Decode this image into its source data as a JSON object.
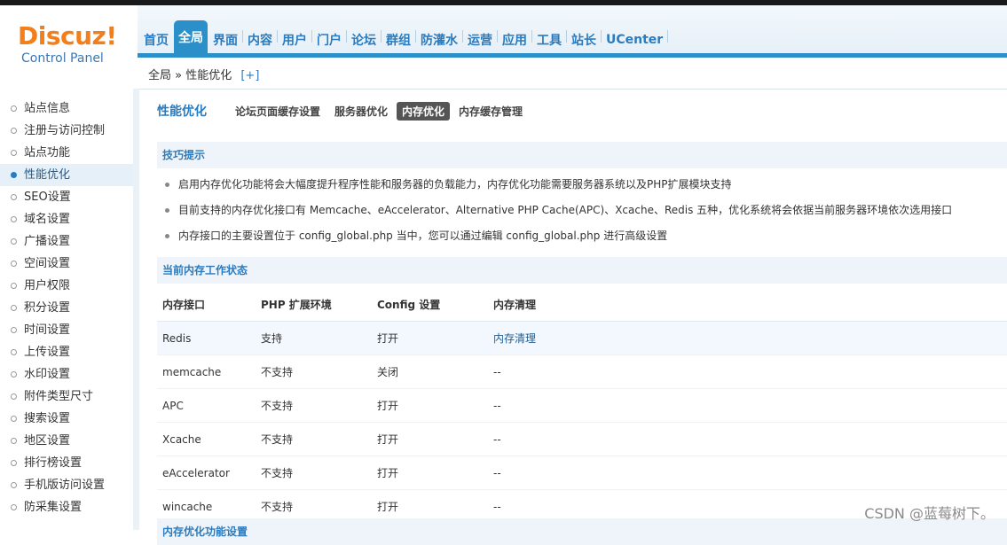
{
  "logo": {
    "title": "Discuz!",
    "subtitle": "Control Panel"
  },
  "nav": {
    "items": [
      "首页",
      "全局",
      "界面",
      "内容",
      "用户",
      "门户",
      "论坛",
      "群组",
      "防灌水",
      "运营",
      "应用",
      "工具",
      "站长",
      "UCenter"
    ],
    "active_index": 1
  },
  "breadcrumb": {
    "path": "全局 » 性能优化",
    "add": "[+]"
  },
  "sidebar": {
    "items": [
      "站点信息",
      "注册与访问控制",
      "站点功能",
      "性能优化",
      "SEO设置",
      "域名设置",
      "广播设置",
      "空间设置",
      "用户权限",
      "积分设置",
      "时间设置",
      "上传设置",
      "水印设置",
      "附件类型尺寸",
      "搜索设置",
      "地区设置",
      "排行榜设置",
      "手机版访问设置",
      "防采集设置"
    ],
    "active_index": 3
  },
  "page": {
    "title": "性能优化",
    "tabs": [
      "论坛页面缓存设置",
      "服务器优化",
      "内存优化",
      "内存缓存管理"
    ],
    "active_tab": 2
  },
  "tips": {
    "title": "技巧提示",
    "items": [
      "启用内存优化功能将会大幅度提升程序性能和服务器的负载能力，内存优化功能需要服务器系统以及PHP扩展模块支持",
      "目前支持的内存优化接口有 Memcache、eAccelerator、Alternative PHP Cache(APC)、Xcache、Redis 五种，优化系统将会依据当前服务器环境依次选用接口",
      "内存接口的主要设置位于 config_global.php 当中，您可以通过编辑 config_global.php 进行高级设置"
    ]
  },
  "status": {
    "title": "当前内存工作状态",
    "headers": [
      "内存接口",
      "PHP 扩展环境",
      "Config 设置",
      "内存清理"
    ],
    "rows": [
      [
        "Redis",
        "支持",
        "打开",
        "内存清理"
      ],
      [
        "memcache",
        "不支持",
        "关闭",
        "--"
      ],
      [
        "APC",
        "不支持",
        "打开",
        "--"
      ],
      [
        "Xcache",
        "不支持",
        "打开",
        "--"
      ],
      [
        "eAccelerator",
        "不支持",
        "打开",
        "--"
      ],
      [
        "wincache",
        "不支持",
        "打开",
        "--"
      ]
    ]
  },
  "next_section": {
    "title": "内存优化功能设置"
  },
  "watermark": "CSDN @蓝莓树下。"
}
